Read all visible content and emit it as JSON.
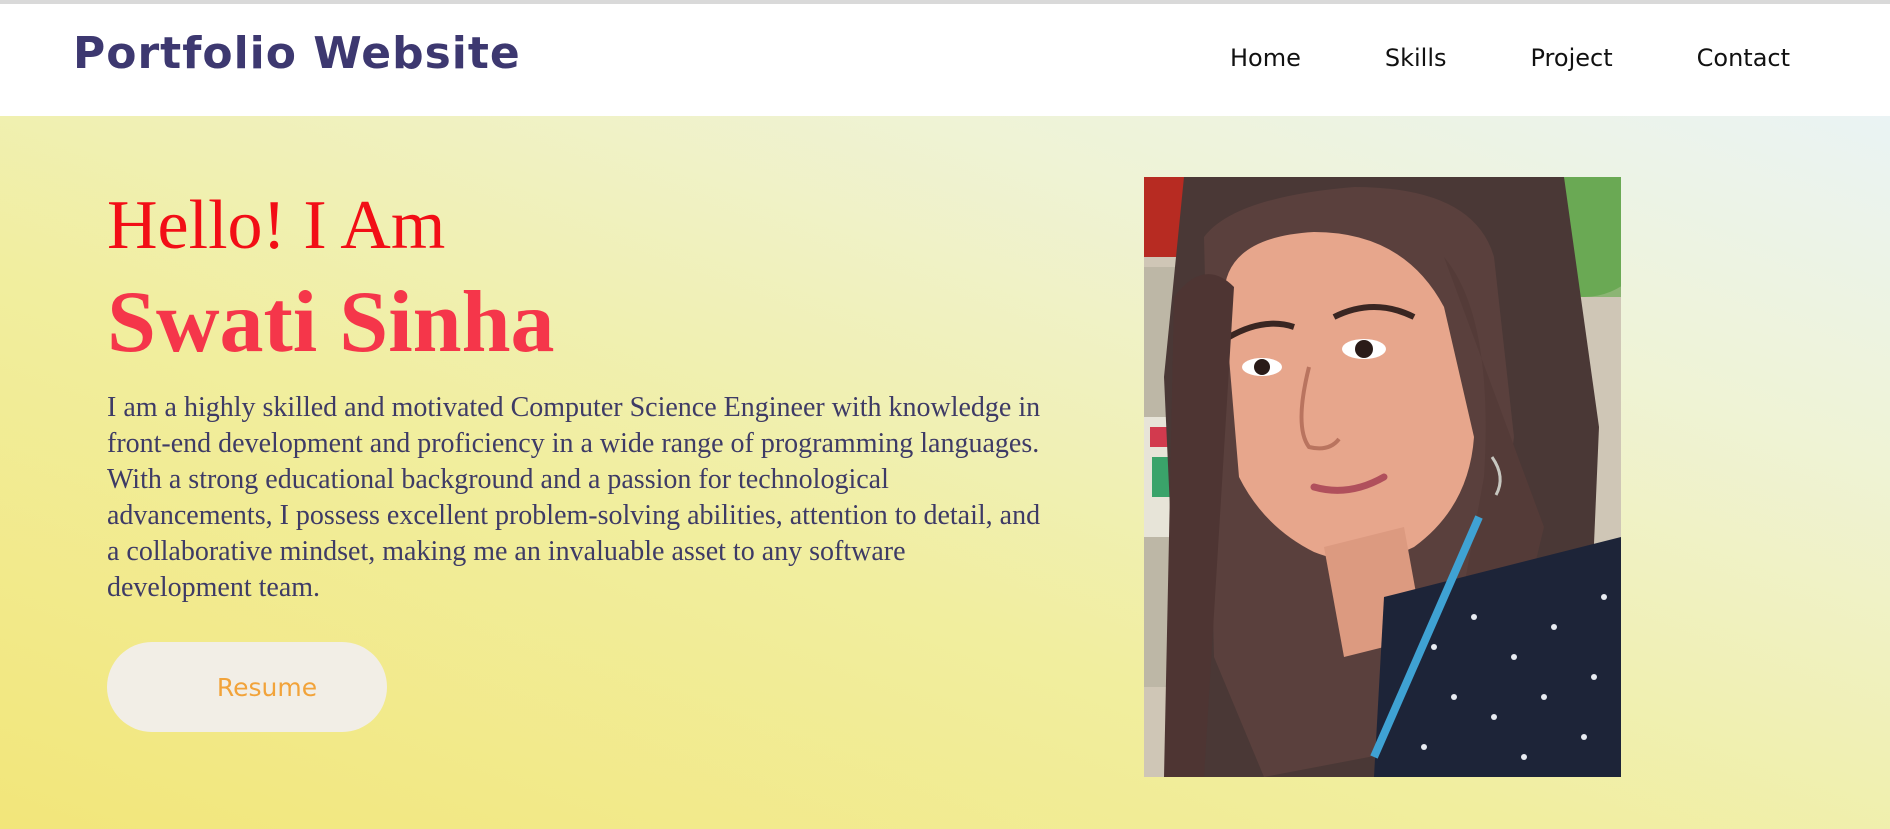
{
  "navbar": {
    "brand": "Portfolio Website",
    "links": [
      "Home",
      "Skills",
      "Project",
      "Contact"
    ]
  },
  "hero": {
    "greeting": "Hello! I Am",
    "name": "Swati Sinha",
    "bio": "I am a highly skilled and motivated Computer Science Engineer with knowledge in front-end development and proficiency in a wide range of programming languages. With a strong educational background and a passion for technological advancements, I possess excellent problem-solving abilities, attention to detail, and a collaborative mindset, making me an invaluable asset to any software development team.",
    "resume_label": "Resume",
    "photo_icon": "profile-photo"
  },
  "colors": {
    "brand": "#3d3870",
    "greeting": "#f20e16",
    "name": "#f5364a",
    "bio": "#3e3b66",
    "resume_text": "#f2a33a",
    "resume_bg": "#f2eee6"
  }
}
